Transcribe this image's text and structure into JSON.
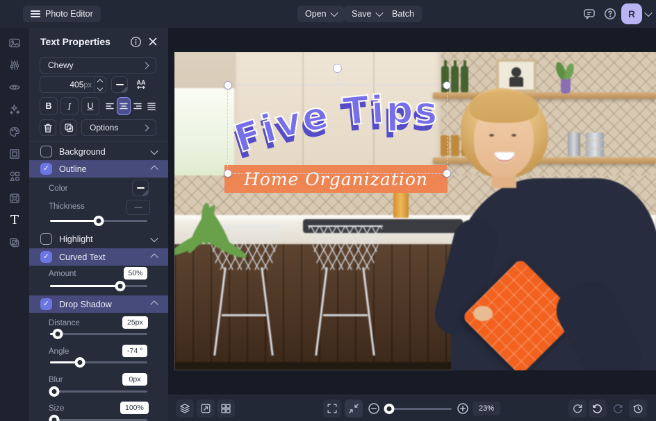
{
  "topbar": {
    "app_title": "Photo Editor",
    "open_label": "Open",
    "save_label": "Save",
    "batch_label": "Batch",
    "avatar_initial": "R"
  },
  "icons": {
    "check": "✓",
    "rail": [
      "photo-icon",
      "adjust-icon",
      "eye-icon",
      "sparkles-icon",
      "palette-icon",
      "frame-icon",
      "shapes-icon",
      "texture-icon",
      "text-tool-icon",
      "duplicate-icon"
    ],
    "topbar_right": [
      "feedback-icon",
      "help-icon",
      "avatar",
      "chevron-down-icon"
    ],
    "bottombar": [
      "layers-icon",
      "canvas-resize-icon",
      "grid-icon",
      "fullscreen-icon",
      "fit-screen-icon",
      "zoom-out-icon",
      "zoom-in-icon",
      "reset-icon",
      "undo-icon",
      "redo-icon",
      "history-icon"
    ],
    "text_tool_glyph": "T",
    "letter_spacing_label": "AA"
  },
  "panel": {
    "title": "Text Properties",
    "font_family": "Chewy",
    "font_size": "405",
    "font_size_unit": "px",
    "bold_label": "B",
    "italic_label": "I",
    "underline_label": "U",
    "options_label": "Options",
    "background_label": "Background",
    "outline_label": "Outline",
    "color_label": "Color",
    "swatch_dash": "—",
    "thickness_label": "Thickness",
    "thickness_value": "—",
    "thickness_pct": 50,
    "highlight_label": "Highlight",
    "curved_label": "Curved Text",
    "amount_label": "Amount",
    "amount_value": "50%",
    "amount_pct": 72,
    "shadow_label": "Drop Shadow",
    "shadow_rows": [
      {
        "label": "Distance",
        "value": "25px",
        "pct": 8
      },
      {
        "label": "Angle",
        "value": "-74 °",
        "pct": 31
      },
      {
        "label": "Blur",
        "value": "0px",
        "pct": 4
      },
      {
        "label": "Size",
        "value": "100%",
        "pct": 4
      }
    ]
  },
  "canvas_text": {
    "headline": "Five Tips",
    "subline": "Home Organization",
    "headline_color": "#776fe8",
    "headline_shadow_color": "#544cc8",
    "banner_color": "#ef8350",
    "selection_color": "#ccd2f7"
  },
  "colors": {
    "accent_purple_row": "#474b7c",
    "checkbox_checked": "#6c76e3",
    "avatar_bg": "#b8b5f3",
    "panel_bg": "#272c3b",
    "topbar_bg": "#232837"
  },
  "bottombar": {
    "zoom_value": "23%",
    "zoom_pct": 6
  }
}
